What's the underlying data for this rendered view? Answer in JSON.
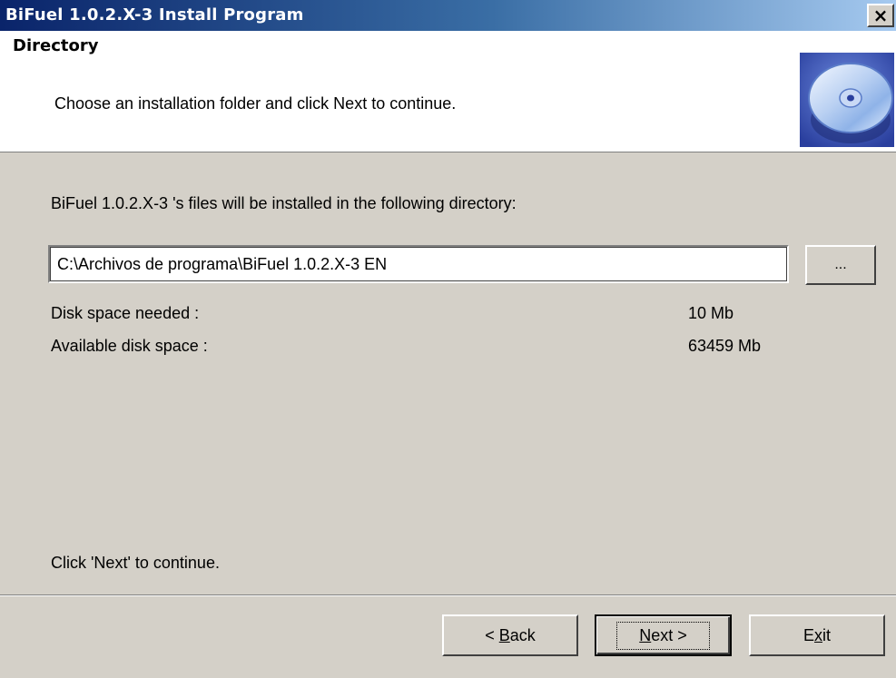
{
  "window": {
    "title": "BiFuel 1.0.2.X-3  Install Program",
    "close_label": "×"
  },
  "header": {
    "title": "Directory",
    "subtitle": "Choose an installation folder and click Next to continue."
  },
  "main": {
    "prompt": "BiFuel 1.0.2.X-3 's files will be installed in the following directory:",
    "path_value": "C:\\Archivos de programa\\BiFuel 1.0.2.X-3 EN",
    "browse_label": "...",
    "disk_needed_label": "Disk space needed :",
    "disk_needed_value": "10 Mb",
    "disk_available_label": "Available disk space :",
    "disk_available_value": "63459 Mb",
    "footer_hint": "Click 'Next' to continue."
  },
  "buttons": {
    "back_prefix": "< ",
    "back_key": "B",
    "back_rest": "ack",
    "next_key": "N",
    "next_rest": "ext >",
    "exit_prefix": "E",
    "exit_key": "x",
    "exit_rest": "it"
  },
  "colors": {
    "titlebar_start": "#0a246a",
    "titlebar_end": "#a6caf0",
    "dialog_bg": "#d4d0c8"
  },
  "icons": {
    "header_icon": "cd-disc-icon"
  }
}
